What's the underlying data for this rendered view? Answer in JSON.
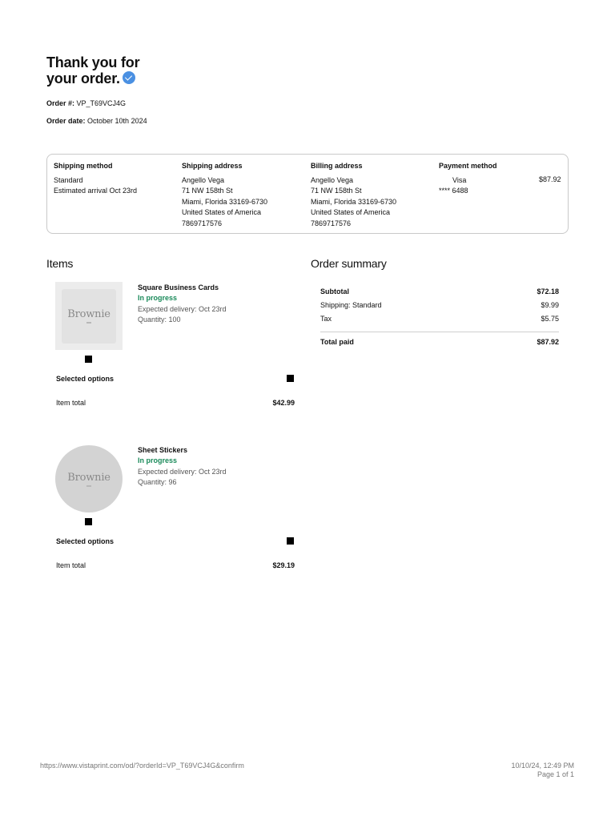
{
  "header": {
    "title_line1": "Thank you for",
    "title_line2": "your order.",
    "order_number_label": "Order #:",
    "order_number": "VP_T69VCJ4G",
    "order_date_label": "Order date:",
    "order_date": "October 10th 2024"
  },
  "info": {
    "shipping_method": {
      "heading": "Shipping method",
      "lines": [
        "Standard",
        "Estimated arrival Oct 23rd"
      ]
    },
    "shipping_address": {
      "heading": "Shipping address",
      "lines": [
        "Angello Vega",
        "71 NW 158th St",
        "Miami, Florida 33169-6730",
        "United States of America",
        "7869717576"
      ]
    },
    "billing_address": {
      "heading": "Billing address",
      "lines": [
        "Angello Vega",
        "71 NW 158th St",
        "Miami, Florida 33169-6730",
        "United States of America",
        "7869717576"
      ]
    },
    "payment_method": {
      "heading": "Payment method",
      "brand": "Visa",
      "card": "**** 6488",
      "amount": "$87.92"
    }
  },
  "items_section": {
    "heading": "Items",
    "items": [
      {
        "name": "Square Business Cards",
        "status": "In progress",
        "delivery": "Expected delivery: Oct 23rd",
        "quantity": "Quantity: 100",
        "thumb_text": "Brownie",
        "options_label": "Selected options",
        "total_label": "Item total",
        "total": "$42.99"
      },
      {
        "name": "Sheet Stickers",
        "status": "In progress",
        "delivery": "Expected delivery: Oct 23rd",
        "quantity": "Quantity: 96",
        "thumb_text": "Brownie",
        "options_label": "Selected options",
        "total_label": "Item total",
        "total": "$29.19"
      }
    ]
  },
  "summary": {
    "heading": "Order summary",
    "subtotal_label": "Subtotal",
    "subtotal": "$72.18",
    "shipping_label": "Shipping: Standard",
    "shipping": "$9.99",
    "tax_label": "Tax",
    "tax": "$5.75",
    "total_label": "Total paid",
    "total": "$87.92"
  },
  "footer": {
    "url": "https://www.vistaprint.com/od/?orderId=VP_T69VCJ4G&confirm",
    "datetime": "10/10/24, 12:49 PM",
    "page": "Page 1 of 1"
  },
  "colors": {
    "status_green": "#1a8a5a",
    "check_blue": "#4a90e2",
    "border": "#c9c9c9"
  },
  "icons": {
    "title_badge": "check-circle-icon"
  }
}
